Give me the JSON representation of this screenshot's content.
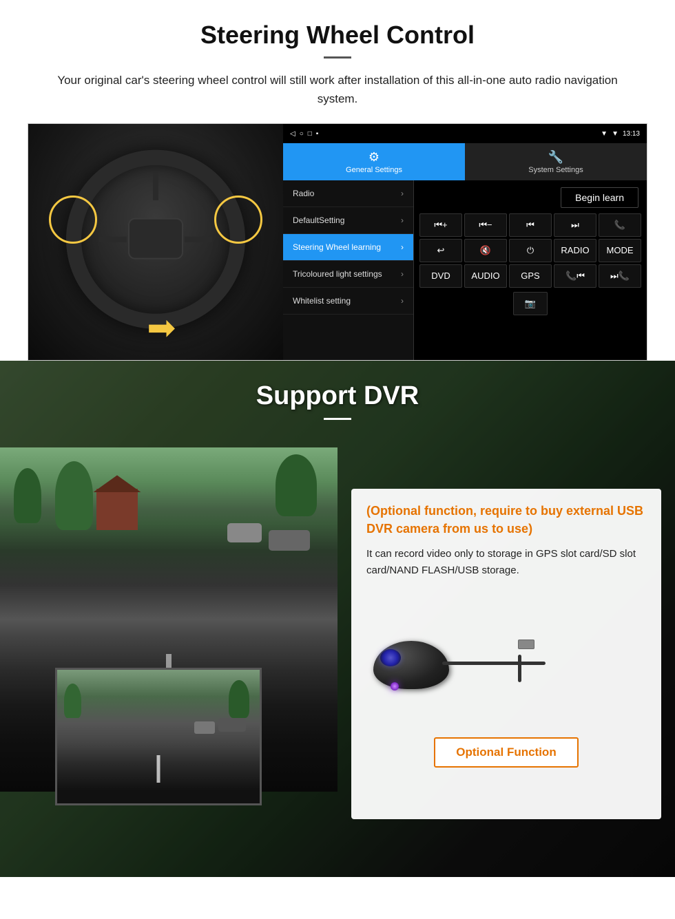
{
  "steering": {
    "title": "Steering Wheel Control",
    "description": "Your original car's steering wheel control will still work after installation of this all-in-one auto radio navigation system.",
    "statusbar": {
      "time": "13:13",
      "wifi_icon": "▼",
      "signal_icon": "▼"
    },
    "tabs": {
      "general": {
        "label": "General Settings",
        "icon": "⚙"
      },
      "system": {
        "label": "System Settings",
        "icon": "🔧"
      }
    },
    "menu": [
      {
        "label": "Radio",
        "active": false
      },
      {
        "label": "DefaultSetting",
        "active": false
      },
      {
        "label": "Steering Wheel learning",
        "active": true
      },
      {
        "label": "Tricoloured light settings",
        "active": false
      },
      {
        "label": "Whitelist setting",
        "active": false
      }
    ],
    "begin_learn_label": "Begin learn",
    "control_buttons": [
      "⏮+",
      "⏮−",
      "⏮⏮",
      "⏭⏭",
      "📞",
      "↩",
      "🔇",
      "⏻",
      "RADIO",
      "MODE",
      "DVD",
      "AUDIO",
      "GPS",
      "📞⏮",
      "⏭📞"
    ]
  },
  "dvr": {
    "title": "Support DVR",
    "optional_text": "(Optional function, require to buy external USB DVR camera from us to use)",
    "description": "It can record video only to storage in GPS slot card/SD slot card/NAND FLASH/USB storage.",
    "optional_function_label": "Optional Function"
  }
}
